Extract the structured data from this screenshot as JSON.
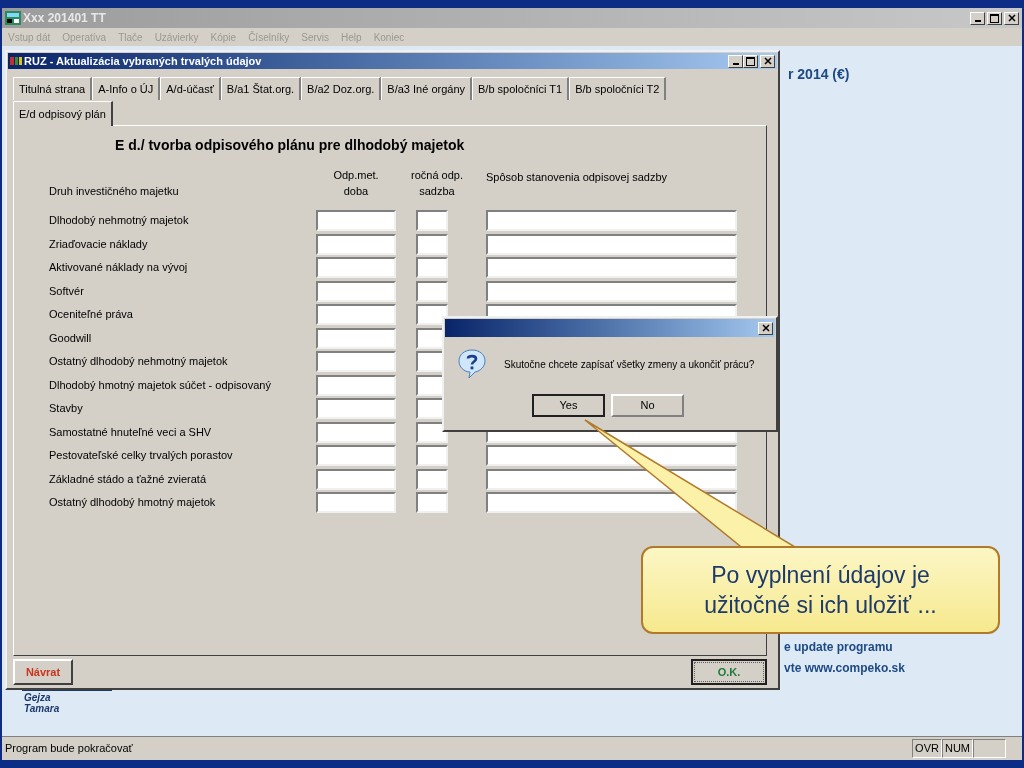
{
  "app_window": {
    "title": "Xxx 201401 TT",
    "menu": [
      {
        "label": "Vstup dát",
        "disabled": true
      },
      {
        "label": "Operatíva",
        "disabled": true
      },
      {
        "label": "Tlače",
        "disabled": true
      },
      {
        "label": "Uzávierky",
        "disabled": true
      },
      {
        "label": "Kópie",
        "disabled": true
      },
      {
        "label": "Číselníky",
        "disabled": true
      },
      {
        "label": "Servis",
        "disabled": true
      },
      {
        "label": "Help",
        "disabled": true
      },
      {
        "label": "Koniec",
        "disabled": true
      }
    ]
  },
  "background_texts": {
    "year": "r 2014 (€)",
    "update": "e update programu",
    "web": "vte www.compeko.sk",
    "signature": [
      "Gejza",
      "Tamara"
    ]
  },
  "form_window": {
    "title": "RUZ - Aktualizácia vybraných trvalých údajov",
    "tab_rows": [
      [
        {
          "label": "Titulná strana",
          "selected": false
        },
        {
          "label": "A-Info o ÚJ",
          "selected": false
        },
        {
          "label": "A/d-účasť",
          "selected": false
        },
        {
          "label": "B/a1 Štat.org.",
          "selected": false
        },
        {
          "label": "B/a2 Doz.org.",
          "selected": false
        },
        {
          "label": "B/a3 Iné orgány",
          "selected": false
        },
        {
          "label": "B/b spoločníci T1",
          "selected": false
        },
        {
          "label": "B/b spoločníci T2",
          "selected": false
        }
      ],
      [
        {
          "label": "E/d odpisový plán",
          "selected": true
        }
      ]
    ],
    "heading": "E  d./ tvorba odpisového plánu pre dlhodobý majetok",
    "columns": {
      "asset": "Druh investičného majetku",
      "period": [
        "Odp.met.",
        "doba"
      ],
      "rate": [
        "ročná odp.",
        "sadzba"
      ],
      "method": "Spôsob stanovenia odpisovej sadzby"
    },
    "rows": [
      "Dlhodobý nehmotný majetok",
      "Zriaďovacie náklady",
      "Aktivované náklady na vývoj",
      "Softvér",
      "Oceniteľné práva",
      "Goodwill",
      "Ostatný dlhodobý nehmotný majetok",
      "Dlhodobý hmotný majetok súčet - odpisovaný",
      "Stavby",
      "Samostatné hnuteľné veci a SHV",
      "Pestovateľské celky trvalých porastov",
      "Základné stádo a ťažné zvieratá",
      "Ostatný dlhodobý hmotný majetok"
    ],
    "buttons": {
      "back": "Návrat",
      "ok": "O.K."
    }
  },
  "dialog": {
    "message": "Skutočne chcete zapísať všetky zmeny a ukončiť prácu?",
    "buttons": [
      {
        "label": "Yes",
        "focused": true
      },
      {
        "label": "No",
        "focused": false
      }
    ]
  },
  "callout": {
    "text": "Po vyplnení údajov je užitočné si ich uložiť ..."
  },
  "status_bar": {
    "message": "Program bude pokračovať",
    "indicators": [
      "OVR",
      "NUM"
    ]
  }
}
